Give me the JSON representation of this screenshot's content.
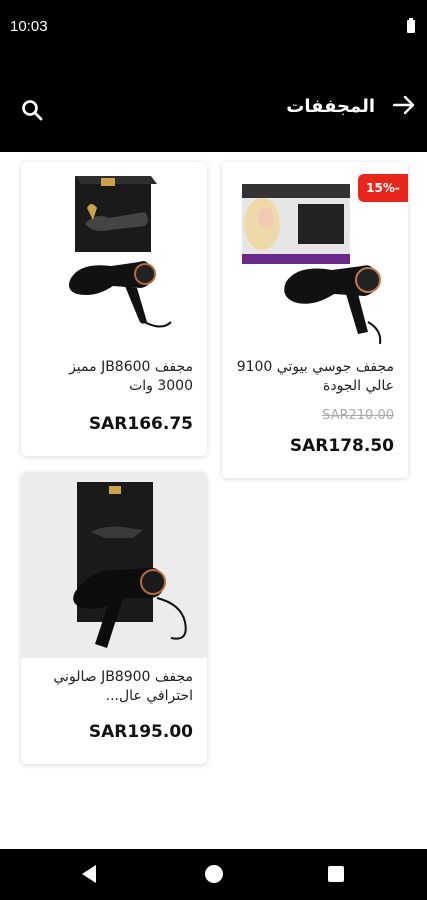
{
  "status": {
    "time": "10:03"
  },
  "header": {
    "title": "المجففات"
  },
  "products": [
    {
      "name": "مجفف JB8600 مميز 3000 وات",
      "price": "SAR166.75"
    },
    {
      "name": "مجفف جوسي بيوتي 9100 عالي الجودة",
      "old_price": "SAR210.00",
      "price": "SAR178.50",
      "discount": "15%-"
    },
    {
      "name": "مجفف JB8900 صالوني احترافي عال...",
      "price": "SAR195.00"
    }
  ],
  "colors": {
    "bar": "#000000",
    "discount": "#e8261c",
    "card_bg": "#ffffff"
  },
  "icons": {
    "back": "arrow-right-icon",
    "search": "search-icon",
    "nav": [
      "back-triangle-icon",
      "home-circle-icon",
      "recents-square-icon"
    ]
  }
}
